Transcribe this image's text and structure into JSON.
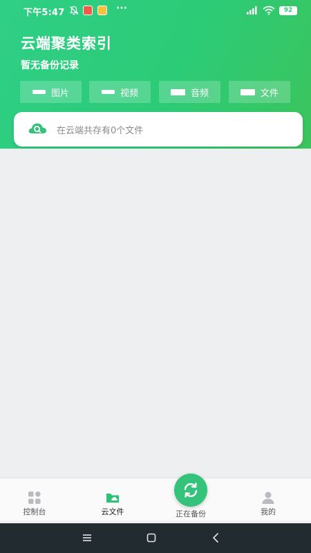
{
  "status_bar": {
    "time": "下午5:47",
    "more": "···",
    "battery": "92",
    "icons": [
      "bell-mute-icon",
      "app-badge-red",
      "app-badge-yellow",
      "hd-signal-icon",
      "wifi-icon",
      "battery-icon"
    ]
  },
  "header": {
    "title": "云端聚类索引",
    "subtitle": "暂无备份记录",
    "categories": [
      {
        "label": "图片",
        "icon": "image-icon"
      },
      {
        "label": "视频",
        "icon": "video-icon"
      },
      {
        "label": "音频",
        "icon": "audio-icon"
      },
      {
        "label": "文件",
        "icon": "file-icon"
      }
    ]
  },
  "search": {
    "text": "在云端共存有0个文件",
    "icon": "cloud-search-icon"
  },
  "tab_bar": {
    "items": [
      {
        "label": "控制台",
        "icon": "dashboard-icon"
      },
      {
        "label": "云文件",
        "icon": "cloud-folder-icon",
        "active": true
      },
      {
        "label": "正在备份",
        "icon": "sync-icon"
      },
      {
        "label": "我的",
        "icon": "user-icon"
      }
    ]
  },
  "colors": {
    "primary": "#2ecb7a",
    "header_gradient_end": "#3cc45d",
    "background": "#eeeff0",
    "nav_bar": "#222b30"
  }
}
